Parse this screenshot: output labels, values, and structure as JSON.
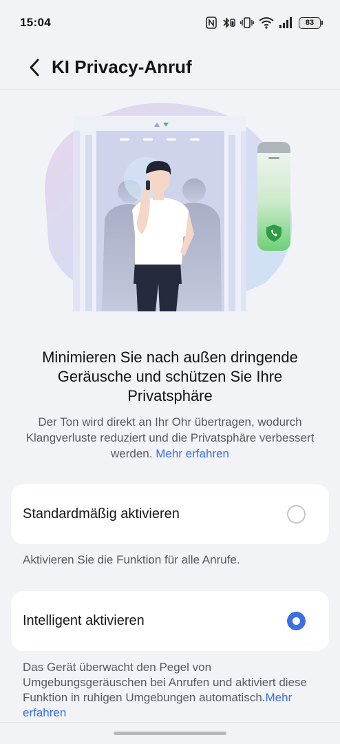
{
  "status_bar": {
    "time": "15:04",
    "battery": "83",
    "icons": [
      "nfc-icon",
      "bluetooth-icon",
      "vibrate-icon",
      "wifi-icon",
      "signal-icon",
      "battery-icon"
    ]
  },
  "header": {
    "title": "KI Privacy-Anruf",
    "back_icon": "chevron-left-icon"
  },
  "intro": {
    "headline": "Minimieren Sie nach außen dringende Geräusche und schützen Sie Ihre Privatsphäre",
    "body": "Der Ton wird direkt an Ihr Ohr übertragen, wodurch Klangverluste reduziert und die Privatsphäre verbessert werden.",
    "link": "Mehr erfahren"
  },
  "options": [
    {
      "label": "Standardmäßig aktivieren",
      "selected": false,
      "description": "Aktivieren Sie die Funktion für alle Anrufe."
    },
    {
      "label": "Intelligent aktivieren",
      "selected": true,
      "description": "Das Gerät überwacht den Pegel von Umgebungsgeräuschen bei Anrufen und aktiviert diese Funktion in ruhigen Umgebungen automatisch.",
      "link": "Mehr erfahren"
    }
  ],
  "colors": {
    "accent": "#3d6fe0",
    "background": "#f2f3f7",
    "card": "#ffffff",
    "shield_green": "#5bbf6a"
  }
}
